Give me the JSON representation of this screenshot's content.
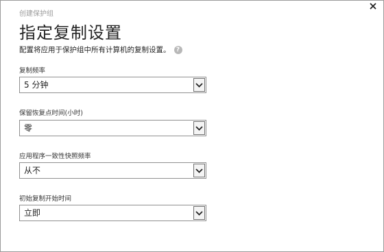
{
  "dialog": {
    "wizard_caption": "创建保护组",
    "title": "指定复制设置",
    "description": "配置将应用于保护组中所有计算机的复制设置。",
    "close_icon": "close-icon",
    "help_icon": "help-icon"
  },
  "fields": [
    {
      "label": "复制频率",
      "value": "5 分钟"
    },
    {
      "label": "保留恢复点时间(小时)",
      "value": "零"
    },
    {
      "label": "应用程序一致性快照频率",
      "value": "从不"
    },
    {
      "label": "初始复制开始时间",
      "value": "立即"
    }
  ]
}
